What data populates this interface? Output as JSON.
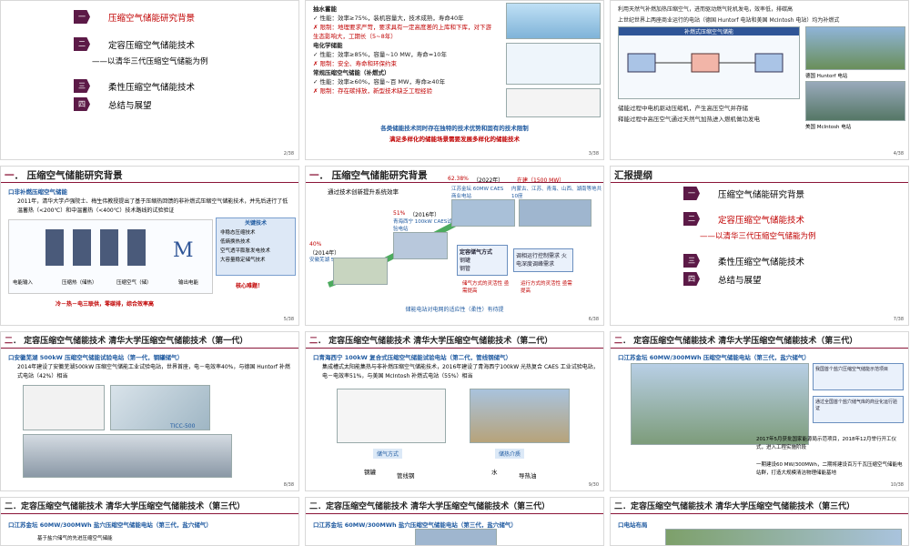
{
  "toc": {
    "items": [
      {
        "num": "一",
        "label": "压缩空气储能研究背景"
      },
      {
        "num": "二",
        "label": "定容压缩空气储能技术"
      },
      {
        "num": "",
        "label": "——以清华三代压缩空气储能为例"
      },
      {
        "num": "三",
        "label": "柔性压缩空气储能技术"
      },
      {
        "num": "四",
        "label": "总结与展望"
      }
    ],
    "page": "2/38"
  },
  "slide_tech_compare": {
    "lines": [
      "抽水蓄能",
      "✓  性能：效率≥75%，装机容量大，技术成熟，寿命40年",
      "✗  限制：地理要求严苛，要求具有一定高度差的上库和下库，对下游生态影响大，工期长（5~8年）",
      "电化学储能",
      "✓  性能：效率≥85%，容量~10 MW，寿命≈10年",
      "✗  限制：安全、寿命和环保约束",
      "常规压缩空气储能（补燃式）",
      "✓  性能：效率≥60%，容量~百 MW，寿命≥40年",
      "✗  限制：存在碳排放，新型技术缺乏工程经验"
    ],
    "footer1": "各类储能技术同时存在独特的技术优势和固有的技术限制",
    "footer2": "满足多样化的储能场景需要发展多样化的储能技术",
    "page": "3/38"
  },
  "slide_huntorf": {
    "intro": "利用天然气补燃加热压缩空气，进而驱动燃气轮机发电，效率低，排碳高",
    "intro2": "上世纪世界上两座商业运行的电站（德国 Huntorf 电站和美国 McIntosh 电站）均为补燃式",
    "diagram_title": "补燃式压缩空气储能",
    "photo1_caption": "德国 Huntorf 电站",
    "photo2_caption": "美国 McIntosh 电站",
    "bullets": [
      "储能过程中电机驱动压缩机，产生高压空气并存储",
      "释能过程中高压空气通过天然气加热进入燃机做功发电"
    ],
    "page": "4/38"
  },
  "slide_research1": {
    "title_num": "一",
    "title": "压缩空气储能研究背景",
    "subtitle": "口非补燃压缩空气储能",
    "body": "2011年，清华大学卢强院士、梅生伟教授提出了基于压缩热回馈的非补燃式压缩空气储能技术，并先后进行了低温蓄热（<200℃）和中温蓄热（<400℃）技术路线的试验验证",
    "tech_title": "关键技术",
    "techs": [
      "非稳态压缩技术",
      "低熵换热技术",
      "空气透平膨胀发电技术",
      "大容量稳定储气技术"
    ],
    "labels": [
      "电能输入",
      "压缩热（储热）",
      "压缩空气（储）",
      "输出电能"
    ],
    "footer": "冷－热－电三联供，零碳排，综合效率高",
    "core": "核心难题！",
    "page": "5/38"
  },
  "slide_research2": {
    "title_num": "一",
    "title": "压缩空气储能研究背景",
    "subtitle": "通过技术创新提升系统效率",
    "p1_pct": "40%",
    "p1_label": "（2014年）",
    "p1_site": "安徽芜湖 500kW",
    "p2_pct": "51%",
    "p2_label": "（2016年）",
    "p2_site": "青海西宁 100kW CAES试验电站",
    "p3_pct": "62.38%",
    "p3_label": "（2022年）",
    "p3_build": "在建（1500 MW）",
    "p3_site": "江苏金坛 60MW CAES商业电站",
    "p3_sites": "内蒙古、江苏、青海、山西、湖南等地共10座",
    "box1": "定容储气方式",
    "box1_items": [
      "钢罐",
      "钢管",
      "盐穴",
      "人工洞室"
    ],
    "box2": "调相运行控制需求 火电深度调峰需求",
    "arrow1": "储气方式的灵活性 亟需提高",
    "arrow2": "运行方式的灵活性 亟需提高",
    "footer": "储能电站对电网的适应性（柔性）有待提",
    "page": "6/38"
  },
  "slide_outline": {
    "title": "汇报提纲",
    "items": [
      {
        "num": "一",
        "label": "压缩空气储能研究背景"
      },
      {
        "num": "二",
        "label": "定容压缩空气储能技术"
      },
      {
        "num": "",
        "label": "——以清华三代压缩空气储能为例"
      },
      {
        "num": "三",
        "label": "柔性压缩空气储能技术"
      },
      {
        "num": "四",
        "label": "总结与展望"
      }
    ],
    "page": "7/38"
  },
  "slide_gen1": {
    "title_num": "二",
    "title": "定容压缩空气储能技术  清华大学压缩空气储能技术（第一代）",
    "subtitle": "口安徽芜湖 500kW 压缩空气储能试验电站（第一代，钢罐储气）",
    "body": "2014年建设了安徽芜湖500kW 压缩空气储能工业试验电站，世界首座，电－电效率40%，与德国 Huntorf 补燃式电站（42%）相当",
    "label": "TICC-500",
    "page": "8/38"
  },
  "slide_gen2": {
    "title_num": "二",
    "title": "定容压缩空气储能技术  清华大学压缩空气储能技术（第二代）",
    "subtitle": "口青海西宁 100kW 复合式压缩空气储能试验电站（第二代，管线钢储气）",
    "body": "集成槽式太阳能集热与非补燃压缩空气储能技术，2016年建设了青海西宁100kW 光热复合 CAES 工业试验电站，电－电效率51%，与美国 McIntosh 补燃式电站（55%）相当",
    "tag1": "储气方式",
    "tag2": "储热介质",
    "w1": "钢罐",
    "w2": "管线钢",
    "w3": "水",
    "w4": "导热油",
    "page": "9/30"
  },
  "slide_gen3": {
    "title_num": "二",
    "title": "定容压缩空气储能技术  清华大学压缩空气储能技术（第三代）",
    "subtitle": "口江苏金坛 60MW/300MWh 压缩空气储能电站（第三代，盐穴储气）",
    "note1": "我国首个盐穴压缩空气储能示范项目",
    "note2": "通过全国首个盐穴储气库的商业化运行验证",
    "body": "2017年5月获批国家能源局示范项目，2018年12月举行开工仪式，进入工程实施阶段",
    "b2": "一期建设60 MW/300MWh，二期将建设百万千瓦压缩空气储能电站群，打造大规模清洁物理储能基地",
    "page": "10/38"
  },
  "bottom": {
    "t9": "二．定容压缩空气储能技术  清华大学压缩空气储能技术（第三代）",
    "s9": "口江苏金坛 60MW/300MWh 盐穴压缩空气储能电站（第三代，盐穴储气）",
    "s9b": "基于盐穴储气的先进压缩空气储能",
    "t10": "二．定容压缩空气储能技术  清华大学压缩空气储能技术（第三代）",
    "s10": "口江苏金坛 60MW/300MWh 盐穴压缩空气储能电站（第三代，盐穴储气）",
    "t11": "二．定容压缩空气储能技术  清华大学压缩空气储能技术（第三代）",
    "s11": "口电站布局"
  }
}
